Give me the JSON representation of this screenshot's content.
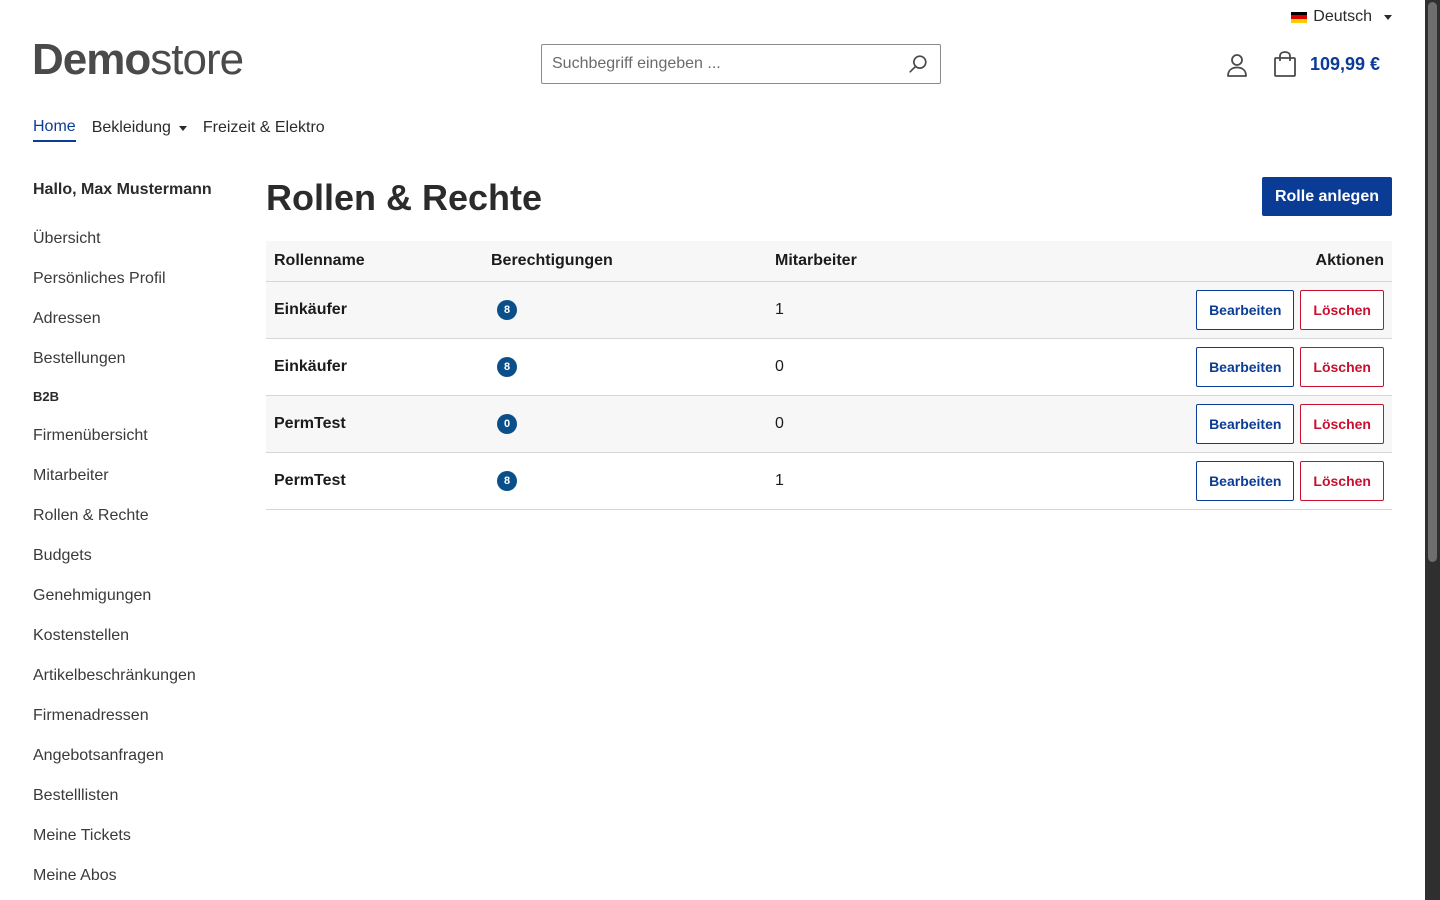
{
  "topbar": {
    "language": "Deutsch",
    "flag_colors": [
      "#000000",
      "#DD0000",
      "#FFCE00"
    ]
  },
  "header": {
    "logo_bold": "Demo",
    "logo_light": "store",
    "search_placeholder": "Suchbegriff eingeben ...",
    "cart_total": "109,99 €"
  },
  "nav": {
    "items": [
      {
        "label": "Home",
        "active": true
      },
      {
        "label": "Bekleidung",
        "dropdown": true
      },
      {
        "label": "Freizeit & Elektro"
      }
    ]
  },
  "sidebar": {
    "greeting": "Hallo, Max Mustermann",
    "items": [
      "Übersicht",
      "Persönliches Profil",
      "Adressen",
      "Bestellungen"
    ],
    "b2b_heading": "B2B",
    "b2b_items": [
      "Firmenübersicht",
      "Mitarbeiter",
      "Rollen & Rechte",
      "Budgets",
      "Genehmigungen",
      "Kostenstellen",
      "Artikelbeschränkungen",
      "Firmenadressen",
      "Angebotsanfragen",
      "Bestelllisten",
      "Meine Tickets",
      "Meine Abos"
    ]
  },
  "main": {
    "title": "Rollen & Rechte",
    "create_button": "Rolle anlegen",
    "table": {
      "headers": [
        "Rollenname",
        "Berechtigungen",
        "Mitarbeiter",
        "Aktionen"
      ],
      "rows": [
        {
          "name": "Einkäufer",
          "permissions": "8",
          "employees": "1"
        },
        {
          "name": "Einkäufer",
          "permissions": "8",
          "employees": "0"
        },
        {
          "name": "PermTest",
          "permissions": "0",
          "employees": "0"
        },
        {
          "name": "PermTest",
          "permissions": "8",
          "employees": "1"
        }
      ],
      "edit_label": "Bearbeiten",
      "delete_label": "Löschen"
    }
  },
  "colors": {
    "primary": "#0b3c95",
    "danger": "#c8102e",
    "badge": "#0b4f8a"
  }
}
